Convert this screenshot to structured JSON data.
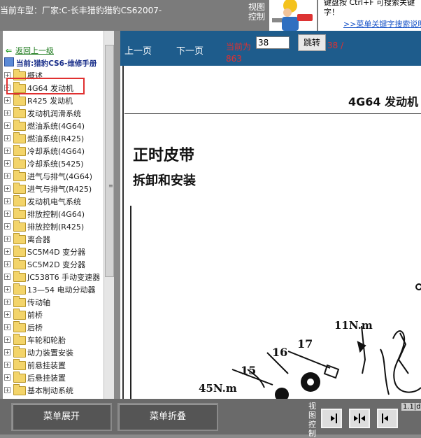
{
  "header": {
    "car_info": "当前车型：厂家:C-长丰猎豹猎豹CS62007-",
    "view_control": "视图控制",
    "hint_text": "键盘按  Ctrl+F  可搜索关键字！",
    "hint_link": ">>菜单关键字搜索说明"
  },
  "tree": {
    "back_label": "返回上一级",
    "current_manual": "当前:猎豹CS6-维修手册",
    "items": [
      "概述",
      "4G64 发动机",
      "R425 发动机",
      "发动机润滑系统",
      "燃油系统(4G64)",
      "燃油系统(R425)",
      "冷却系统(4G64)",
      "冷却系统(5425)",
      "进气与排气(4G64)",
      "进气与排气(R425)",
      "发动机电气系统",
      "排放控制(4G64)",
      "排放控制(R425)",
      "离合器",
      "SC5M4D 变分器",
      "SC5M2D 变分器",
      "JC538T6 手动变速器",
      "13—54 电动分动器",
      "传动轴",
      "前桥",
      "后桥",
      "车轮和轮胎",
      "动力装置安装",
      "前悬挂装置",
      "后悬挂装置",
      "基本制动系统"
    ]
  },
  "nav": {
    "prev": "上一页",
    "next": "下一页",
    "current_label": "当前为",
    "page_value": "38",
    "jump": "跳转",
    "page_count_a": "38 /",
    "page_count_b": "863"
  },
  "document": {
    "header": "4G64 发动机",
    "title": "正时皮带",
    "subtitle": "拆卸和安装",
    "labels": [
      "11N.m",
      "17",
      "16",
      "15",
      "45N.m"
    ]
  },
  "bottom": {
    "expand": "菜单展开",
    "collapse": "菜单折叠",
    "view_control": "视图控制",
    "ratio": "1.1|d"
  }
}
